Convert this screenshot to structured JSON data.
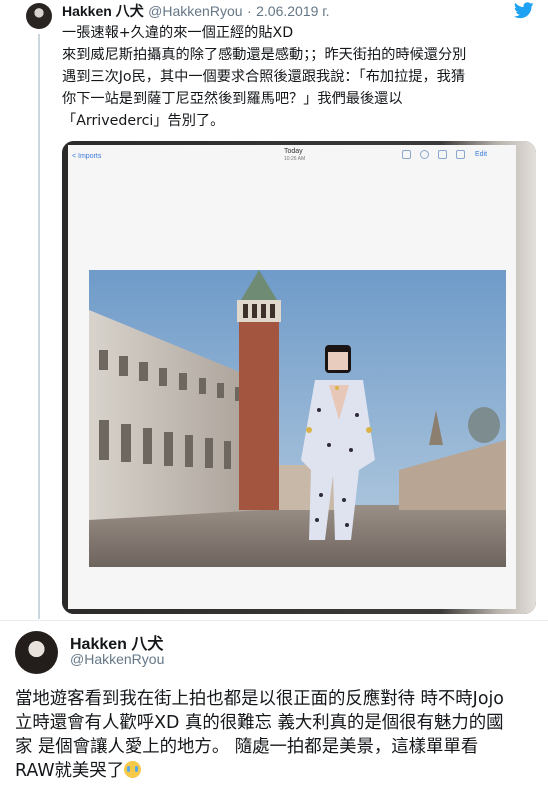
{
  "tweet1": {
    "author_name": "Hakken 八犬",
    "author_handle": "@HakkenRyou",
    "separator": "·",
    "date": "2.06.2019 г.",
    "lines": [
      "一張速報+久違的來一個正經的貼XD",
      "來到威尼斯拍攝真的除了感動還是感動；；昨天街拍的時候還分別",
      "遇到三次Jo民，其中一個要求合照後還跟我說：「布加拉提，我猜",
      "你下一站是到薩丁尼亞然後到羅馬吧？」我們最後還以",
      "「Arrivederci」告別了。"
    ],
    "photo": {
      "back_label": "< Imports",
      "title": "Today",
      "time": "10:26 AM",
      "edit_label": "Edit"
    }
  },
  "tweet2": {
    "author_name": "Hakken 八犬",
    "author_handle": "@HakkenRyou",
    "lines": [
      "當地遊客看到我在街上拍也都是以很正面的反應對待 時不時Jojo",
      "立時還會有人歡呼XD 真的很難忘 義大利真的是個很有魅力的國",
      "家 是個會讓人愛上的地方。 隨處一拍都是美景，這樣單單看",
      "RAW就美哭了"
    ],
    "emoji_name": "loudly-crying-face-icon"
  },
  "colors": {
    "text": "#14171a",
    "muted": "#657786",
    "twitter_blue": "#1da1f2",
    "divider": "#e6ecf0"
  }
}
